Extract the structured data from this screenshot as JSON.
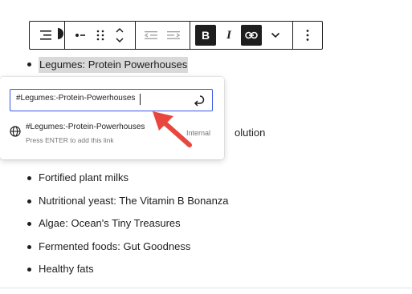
{
  "toolbar": {
    "buttons": [
      "list-icon",
      "bullet-dot-icon",
      "drag-handle-icon",
      "move-up-down-icon",
      "outdent-icon",
      "indent-icon",
      "bold-icon",
      "italic-icon",
      "link-icon",
      "chevron-down-icon",
      "more-options-icon"
    ],
    "bold_label": "B",
    "italic_label": "I"
  },
  "list": {
    "items": [
      "Legumes: Protein Powerhouses",
      "olution",
      "Fortified plant milks",
      "Nutritional yeast: The Vitamin B Bonanza",
      "Algae: Ocean's Tiny Treasures",
      "Fermented foods: Gut Goodness",
      "Healthy fats"
    ]
  },
  "link_popover": {
    "input_value": "#Legumes:-Protein-Powerhouses",
    "suggestion_title": "#Legumes:-Protein-Powerhouses",
    "suggestion_hint": "Press ENTER to add this link",
    "suggestion_type": "Internal"
  },
  "colors": {
    "accent": "#3858e9",
    "arrow": "#e8463f",
    "text": "#1e1e1e",
    "highlight": "#d9d9d9"
  }
}
